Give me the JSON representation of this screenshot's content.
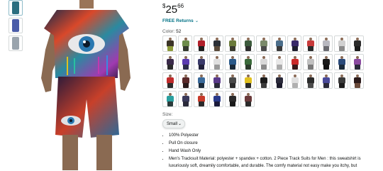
{
  "gallery": {
    "thumbnails": [
      {
        "name": "thumb-1",
        "color": "#2b6e7f"
      },
      {
        "name": "thumb-2",
        "color": "#4a5ca8"
      },
      {
        "name": "thumb-3",
        "color": "#9aa4ad"
      }
    ]
  },
  "product": {
    "price": {
      "currency": "$",
      "whole": "25",
      "fraction": "66"
    },
    "returns_label": "FREE Returns",
    "color_label": "Color:",
    "color_value": "52",
    "size_label": "Size:",
    "size_value": "Small",
    "swatches": [
      [
        "#3a3326",
        "#8c9a3a"
      ],
      [
        "#6d8c4a",
        "#343a2e"
      ],
      [
        "#b11f2a",
        "#1d1d1d"
      ],
      [
        "#2b2f36",
        "#5a4a3a"
      ],
      [
        "#6a7a3a",
        "#3a3a2e"
      ],
      [
        "#3c5a3c",
        "#2d2d2d"
      ],
      [
        "#7a8a6a",
        "#4a4a4a"
      ],
      [
        "#4a6d8a",
        "#3a3a3a"
      ],
      [
        "#3a2a6a",
        "#1f1f2f"
      ],
      [
        "#c83a3a",
        "#2a2a2a"
      ],
      [
        "#b8b8c0",
        "#6a6a70"
      ],
      [
        "#d0d0d0",
        "#8a8a8a"
      ],
      [
        "#2a2a2a",
        "#1a1a1a"
      ],
      [
        "#3a2a4a",
        "#2a2a2a"
      ],
      [
        "#5a3ab0",
        "#2a2a4a"
      ],
      [
        "#3a3a6a",
        "#20203a"
      ],
      [
        "#e0e0e0",
        "#9a9a9a"
      ],
      [
        "#2a5a8a",
        "#1a2a3a"
      ],
      [
        "#3a6a3a",
        "#2a3a2a"
      ],
      [
        "#d8d8d8",
        "#8a8a8a"
      ],
      [
        "#e8e8e8",
        "#aaaaaa"
      ],
      [
        "#cc2a2a",
        "#3a1a1a"
      ],
      [
        "#c0c0c0",
        "#7a7a7a"
      ],
      [
        "#1a1a1a",
        "#111111"
      ],
      [
        "#2a4a7a",
        "#1a2a3a"
      ],
      [
        "#8a4aa0",
        "#2a2a3a"
      ],
      [
        "#c02a2a",
        "#2a2a2a"
      ],
      [
        "#5a2a2a",
        "#2a1a1a"
      ],
      [
        "#3a6a9a",
        "#1a2a3a"
      ],
      [
        "#5a3a8a",
        "#2a2a3a"
      ],
      [
        "#4a4a4a",
        "#2a2a2a"
      ],
      [
        "#e0c020",
        "#2a2a2a"
      ],
      [
        "#1a1a1a",
        "#3a3a3a"
      ],
      [
        "#2a2a3a",
        "#1a1a2a"
      ],
      [
        "#e0e0e0",
        "#b0b0b0"
      ],
      [
        "#2a2a2a",
        "#4a4a4a"
      ],
      [
        "#4a4a9a",
        "#2a2a3a"
      ],
      [
        "#3a3a3a",
        "#1a1a1a"
      ],
      [
        "#2a1a1a",
        "#6a4a3a"
      ],
      [
        "#2aa0a0",
        "#2a3a3a"
      ],
      [
        "#3a3a5a",
        "#2a2a3a"
      ],
      [
        "#c83a2a",
        "#2a2a2a"
      ],
      [
        "#2a3a8a",
        "#1a1a3a"
      ],
      [
        "#2a2a2a",
        "#1a1a1a"
      ],
      [
        "#6a3a3a",
        "#2a2a2a"
      ]
    ],
    "bullets": [
      "100% Polyester",
      "Pull On closure",
      "Hand Wash Only",
      "Men's Tracksuit Material: polyester + spandex + cotton. 2 Piece Track Suits for Men : this sweatshirt is luxuriously soft, dreamily comfortable, and durable. The comfy material not easy make you itchy, but"
    ]
  }
}
